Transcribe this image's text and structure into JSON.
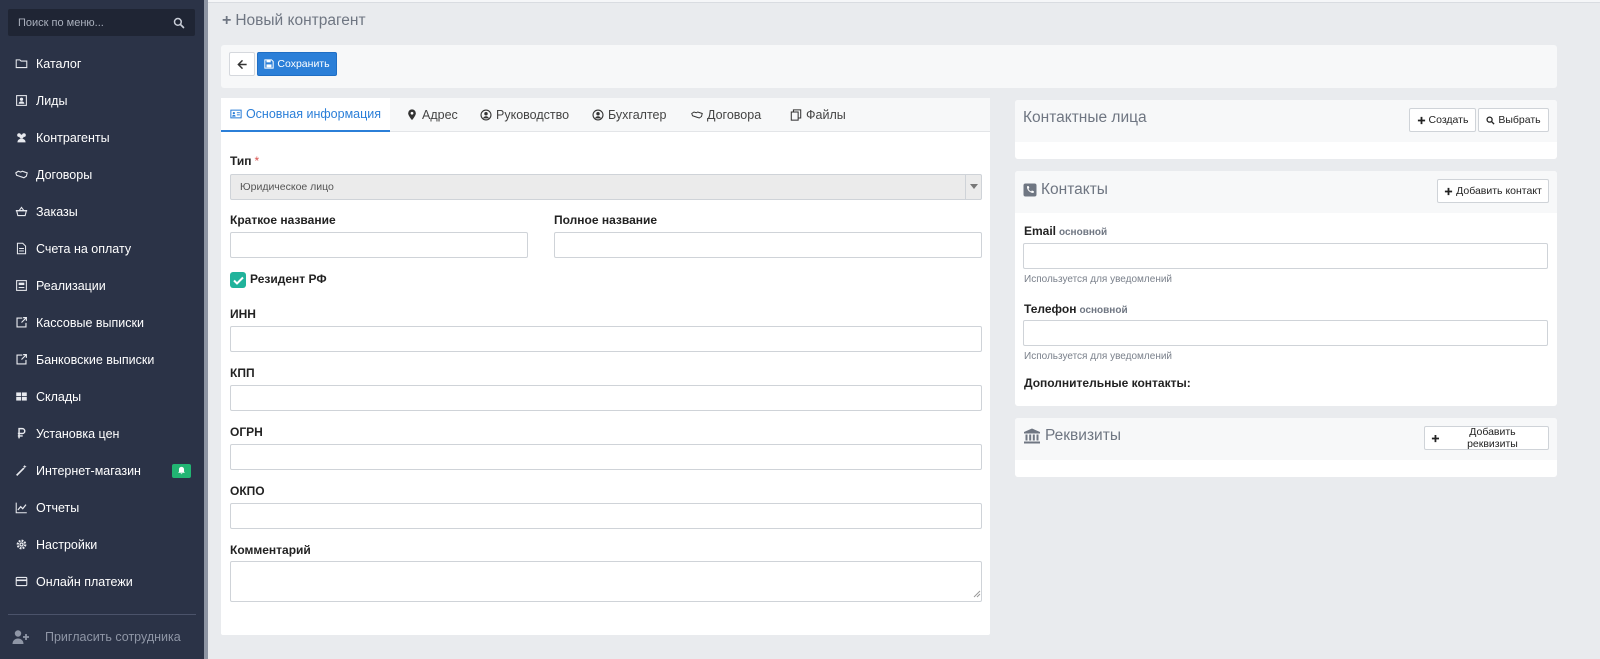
{
  "sidebar": {
    "search_placeholder": "Поиск по меню...",
    "items": [
      {
        "label": "Каталог",
        "icon": "folder-icon"
      },
      {
        "label": "Лиды",
        "icon": "id-card-icon"
      },
      {
        "label": "Контрагенты",
        "icon": "users-icon"
      },
      {
        "label": "Договоры",
        "icon": "handshake-icon"
      },
      {
        "label": "Заказы",
        "icon": "basket-icon"
      },
      {
        "label": "Счета на оплату",
        "icon": "document-icon"
      },
      {
        "label": "Реализации",
        "icon": "register-icon"
      },
      {
        "label": "Кассовые выписки",
        "icon": "export-icon"
      },
      {
        "label": "Банковские выписки",
        "icon": "export-icon"
      },
      {
        "label": "Склады",
        "icon": "grid-icon"
      },
      {
        "label": "Установка цен",
        "icon": "ruble-icon"
      },
      {
        "label": "Интернет-магазин",
        "icon": "magic-wand-icon",
        "badge_icon": "bell-icon"
      },
      {
        "label": "Отчеты",
        "icon": "line-chart-icon"
      },
      {
        "label": "Настройки",
        "icon": "gear-icon"
      },
      {
        "label": "Онлайн платежи",
        "icon": "credit-card-icon"
      }
    ],
    "invite_label": "Пригласить сотрудника"
  },
  "header": {
    "title": "Новый контрагент"
  },
  "toolbar": {
    "save_label": "Сохранить"
  },
  "tabs": [
    {
      "label": "Основная информация",
      "active": true
    },
    {
      "label": "Адрес",
      "active": false
    },
    {
      "label": "Руководство",
      "active": false
    },
    {
      "label": "Бухгалтер",
      "active": false
    },
    {
      "label": "Договора",
      "active": false
    },
    {
      "label": "Файлы",
      "active": false
    }
  ],
  "form": {
    "type_label": "Тип",
    "required_mark": "*",
    "type_value": "Юридическое лицо",
    "short_name_label": "Краткое название",
    "full_name_label": "Полное название",
    "resident_label": "Резидент РФ",
    "resident_checked": true,
    "inn_label": "ИНН",
    "kpp_label": "КПП",
    "ogrn_label": "ОГРН",
    "okpo_label": "ОКПО",
    "comment_label": "Комментарий"
  },
  "contact_persons": {
    "title": "Контактные лица",
    "create_label": "Создать",
    "select_label": "Выбрать"
  },
  "contacts": {
    "title": "Контакты",
    "add_label": "Добавить контакт",
    "email_label": "Email",
    "email_sub": "основной",
    "email_hint": "Используется для уведомлений",
    "phone_label": "Телефон",
    "phone_sub": "основной",
    "phone_hint": "Используется для уведомлений",
    "additional_label": "Дополнительные контакты:"
  },
  "requisites": {
    "title": "Реквизиты",
    "add_label": "Добавить реквизиты"
  },
  "colors": {
    "sidebar_bg": "#2b3347",
    "accent": "#2b7fd8",
    "checkbox": "#20b39b",
    "badge": "#22b573"
  }
}
